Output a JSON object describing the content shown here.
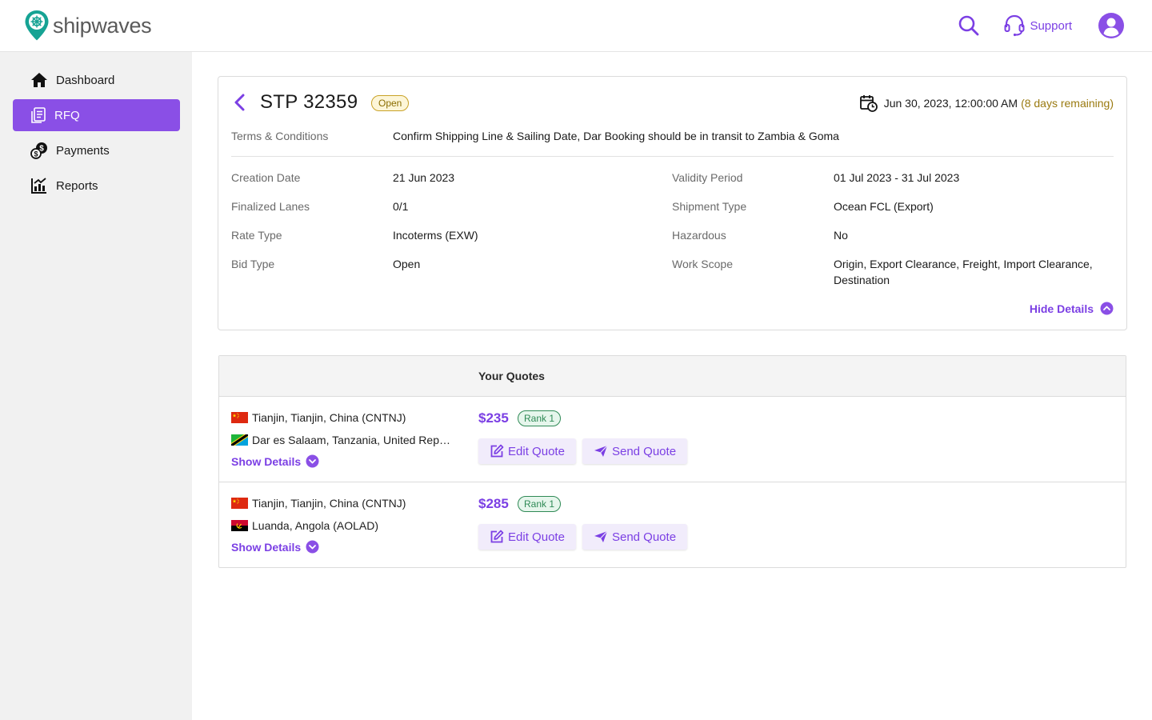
{
  "app": {
    "logo_text": "shipwaves",
    "brand_color": "#7b3fe4",
    "accent_teal": "#16a394"
  },
  "header": {
    "search_icon": "search-icon",
    "support_label": "Support",
    "support_icon": "headset-icon",
    "avatar_icon": "user-avatar-icon"
  },
  "sidebar": {
    "items": [
      {
        "label": "Dashboard",
        "icon": "home-icon",
        "active": false
      },
      {
        "label": "RFQ",
        "icon": "document-list-icon",
        "active": true
      },
      {
        "label": "Payments",
        "icon": "coins-icon",
        "active": false
      },
      {
        "label": "Reports",
        "icon": "bar-chart-icon",
        "active": false
      }
    ]
  },
  "rfq": {
    "title": "STP 32359",
    "status": "Open",
    "deadline": "Jun 30, 2023, 12:00:00 AM",
    "remaining": "(8 days remaining)",
    "terms_label": "Terms & Conditions",
    "terms_value": "Confirm Shipping Line & Sailing Date, Dar Booking should be in transit to Zambia & Goma",
    "details_left": [
      {
        "label": "Creation Date",
        "value": "21 Jun 2023"
      },
      {
        "label": "Finalized Lanes",
        "value": "0/1"
      },
      {
        "label": "Rate Type",
        "value": "Incoterms (EXW)"
      },
      {
        "label": "Bid Type",
        "value": "Open"
      }
    ],
    "details_right": [
      {
        "label": "Validity Period",
        "value": "01 Jul 2023 - 31 Jul 2023"
      },
      {
        "label": "Shipment Type",
        "value": "Ocean FCL (Export)"
      },
      {
        "label": "Hazardous",
        "value": "No"
      },
      {
        "label": "Work Scope",
        "value": "Origin, Export Clearance, Freight, Import Clearance, Destination"
      }
    ],
    "hide_details_label": "Hide Details"
  },
  "quotes": {
    "header_label": "Your Quotes",
    "rows": [
      {
        "origin": "Tianjin, Tianjin, China (CNTNJ)",
        "origin_flag": "china-flag",
        "destination": "Dar es Salaam, Tanzania, United Republic of (TZDAR)",
        "destination_flag": "tanzania-flag",
        "show_details_label": "Show Details",
        "price": "$235",
        "rank": "Rank 1",
        "edit_label": "Edit Quote",
        "send_label": "Send Quote"
      },
      {
        "origin": "Tianjin, Tianjin, China (CNTNJ)",
        "origin_flag": "china-flag",
        "destination": "Luanda, Angola (AOLAD)",
        "destination_flag": "angola-flag",
        "show_details_label": "Show Details",
        "price": "$285",
        "rank": "Rank 1",
        "edit_label": "Edit Quote",
        "send_label": "Send Quote"
      }
    ]
  }
}
